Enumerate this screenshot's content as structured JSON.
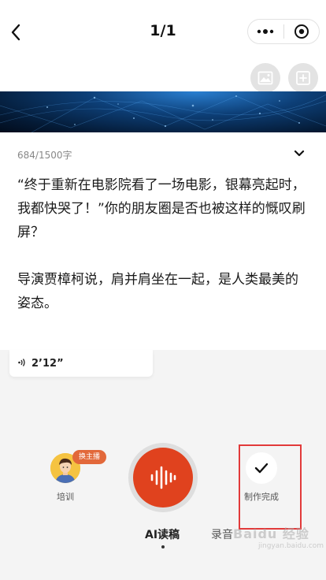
{
  "header": {
    "title": "1/1",
    "back_icon": "chevron-left-icon",
    "more_icon": "more-dots-icon",
    "close_icon": "target-icon"
  },
  "toolbar": {
    "image_icon": "image-icon",
    "add_icon": "add-box-icon"
  },
  "editor": {
    "char_count": "684/1500字",
    "collapse_icon": "chevron-down-icon",
    "paragraphs": [
      "“终于重新在电影院看了一场电影，银幕亮起时，我都快哭了！”你的朋友圈是否也被这样的慨叹刷屏？",
      "导演贾樟柯说，肩并肩坐在一起，是人类最美的姿态。"
    ]
  },
  "audio": {
    "icon": "sound-wave-icon",
    "duration": "2’12”"
  },
  "controls": {
    "anchor_badge": "换主播",
    "anchor_label": "培训",
    "done_label": "制作完成",
    "colors": {
      "record": "#e0421e",
      "badge": "#e2683a",
      "highlight": "#e23a3a"
    }
  },
  "modes": {
    "active": "AI读稿",
    "inactive": "录音"
  },
  "watermark": {
    "text": "Baidu 经验",
    "sub": "jingyan.baidu.com"
  }
}
